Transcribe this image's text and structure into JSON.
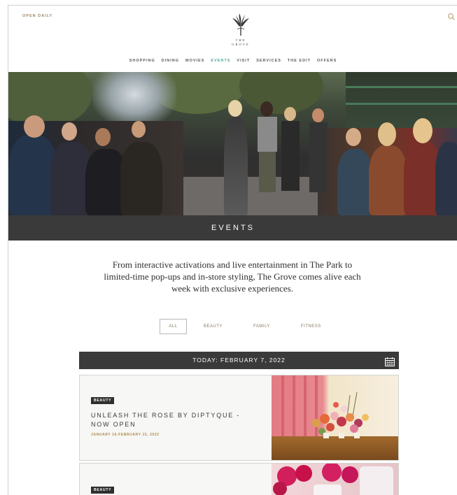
{
  "header": {
    "open_daily": "OPEN DAILY",
    "logo_text_line1": "THE",
    "logo_text_line2": "GROVE",
    "nav": [
      "SHOPPING",
      "DINING",
      "MOVIES",
      "EVENTS",
      "VISIT",
      "SERVICES",
      "THE EDIT",
      "OFFERS"
    ],
    "active_nav": "EVENTS",
    "icons": {
      "search": "search-icon",
      "logo": "grove-logo-icon"
    }
  },
  "hero": {
    "banner_title": "EVENTS"
  },
  "intro": {
    "text": "From interactive activations and live entertainment in The Park to limited-time pop-ups and in-store styling, The Grove comes alive each week with exclusive experiences."
  },
  "filters": {
    "all": "ALL",
    "beauty": "BEAUTY",
    "family": "FAMILY",
    "fitness": "FITNESS",
    "selected": "ALL"
  },
  "date_bar": {
    "label": "TODAY: FEBRUARY 7, 2022",
    "icon": "calendar-icon"
  },
  "events": [
    {
      "badge": "BEAUTY",
      "title": "UNLEASH THE ROSE BY DIPTYQUE - NOW OPEN",
      "dates": "JANUARY 16-FEBRUARY 15, 2022"
    },
    {
      "badge": "BEAUTY"
    }
  ],
  "colors": {
    "accent_teal": "#4ea89a",
    "gold": "#9a8565",
    "dark_bar": "#3a3a3a"
  }
}
